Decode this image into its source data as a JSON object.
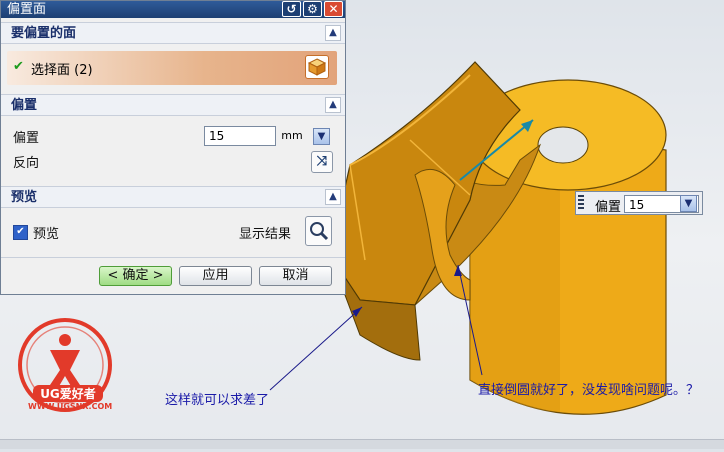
{
  "dialog": {
    "title": "偏置面",
    "sections": {
      "faces": {
        "header": "要偏置的面",
        "select_label": "选择面 (2)"
      },
      "offset": {
        "header": "偏置",
        "offset_label": "偏置",
        "offset_value": "15",
        "unit": "mm",
        "reverse_label": "反向"
      },
      "preview": {
        "header": "预览",
        "preview_label": "预览",
        "show_result_label": "显示结果"
      }
    },
    "buttons": {
      "ok": "< 确定 >",
      "apply": "应用",
      "cancel": "取消"
    }
  },
  "floating_field": {
    "label": "偏置",
    "value": "15"
  },
  "annotations": {
    "left_note": "这样就可以求差了",
    "right_note": "直接倒圆就好了，没发现啥问题呢。？"
  },
  "logo": {
    "brand": "UG爱好者",
    "url": "WWW.UGSNX.COM"
  },
  "colors": {
    "model_fill": "#f0b21f",
    "model_dark": "#b87a12",
    "accent_blue": "#2f5b99"
  }
}
